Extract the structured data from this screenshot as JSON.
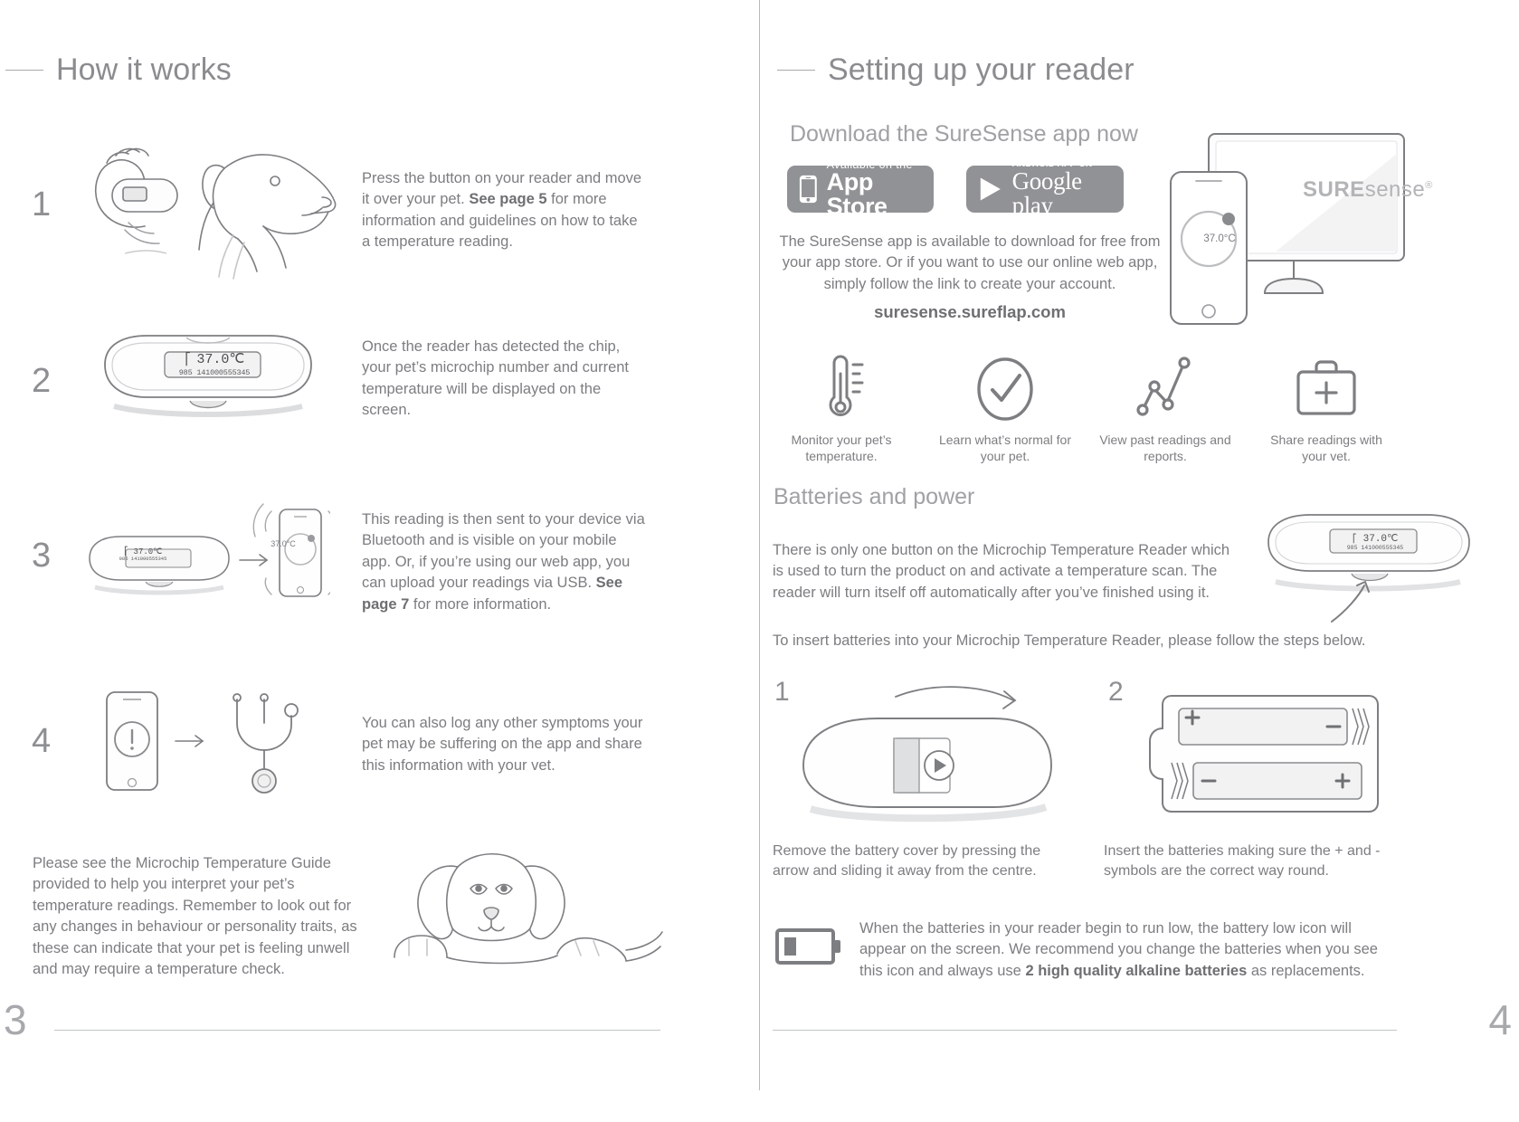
{
  "left_page": {
    "heading": "How it works",
    "folio": "3",
    "steps": [
      {
        "num": "1",
        "text_parts": [
          {
            "t": "Press the button on your reader and move it over your pet. ",
            "b": false
          },
          {
            "t": "See page 5",
            "b": true
          },
          {
            "t": " for more information and guidelines on how to take a temperature reading.",
            "b": false
          }
        ],
        "illustration": "dog-with-reader-illustration"
      },
      {
        "num": "2",
        "text_parts": [
          {
            "t": "Once the reader has detected the chip, your pet’s microchip number and current temperature will be displayed on the screen.",
            "b": false
          }
        ],
        "illustration": "reader-device-illustration"
      },
      {
        "num": "3",
        "text_parts": [
          {
            "t": "This reading is then sent to your device via Bluetooth and is visible on your mobile app. Or, if you’re using our web app, you can upload your readings via USB. ",
            "b": false
          },
          {
            "t": "See page 7",
            "b": true
          },
          {
            "t": " for more information.",
            "b": false
          }
        ],
        "illustration": "reader-to-phone-illustration"
      },
      {
        "num": "4",
        "text_parts": [
          {
            "t": "You can also log any other symptoms your pet may be suffering on the app and share this information with your vet.",
            "b": false
          }
        ],
        "illustration": "phone-to-stethoscope-illustration"
      }
    ],
    "footnote": "Please see the Microchip Temperature Guide provided to help you interpret your pet’s temperature readings. Remember to look out for any changes in behaviour or personality traits, as these can indicate that your pet is feeling unwell and may require a temperature check.",
    "footnote_illustration": "resting-dog-illustration",
    "reader_display": {
      "bluetooth_icon": "bluetooth-icon",
      "temperature": "37.0℃",
      "microchip_number": "985 141000555345"
    },
    "phone_display": {
      "temperature": "37.0°C"
    }
  },
  "right_page": {
    "heading": "Setting up your reader",
    "folio": "4",
    "download_section": {
      "sub_heading": "Download the SureSense app now",
      "badges": [
        {
          "name": "app-store-badge",
          "small": "Available on the",
          "big": "App Store",
          "icon": "iphone-icon"
        },
        {
          "name": "google-play-badge",
          "small": "ANDROID APP ON",
          "big": "Google play",
          "icon": "play-triangle-icon"
        }
      ],
      "paragraph": "The SureSense app is available to download for free from your app store. Or if you want to use our online web app, simply follow the link to create your account.",
      "url": "suresense.sureflap.com",
      "device_mockup": {
        "monitor_logo_sure": "SURE",
        "monitor_logo_sense": "sense",
        "monitor_logo_mark": "®",
        "phone_temperature": "37.0°C"
      },
      "features": [
        {
          "icon": "thermometer-icon",
          "caption": "Monitor your pet’s temperature."
        },
        {
          "icon": "check-circle-icon",
          "caption": "Learn what’s normal for your pet."
        },
        {
          "icon": "line-chart-icon",
          "caption": "View past readings and reports."
        },
        {
          "icon": "medical-bag-icon",
          "caption": "Share readings with your vet."
        }
      ]
    },
    "batteries_section": {
      "sub_heading": "Batteries and power",
      "paragraph_1": "There is only one button on the Microchip Temperature Reader which is used to turn the product on and activate a temperature scan. The reader will turn itself off automatically after you’ve finished using it.",
      "paragraph_2": "To insert batteries into your Microchip Temperature Reader, please follow the steps below.",
      "reader_display": {
        "bluetooth_icon": "bluetooth-icon",
        "temperature": "37.0℃",
        "microchip_number": "985 141000555345"
      },
      "steps": [
        {
          "num": "1",
          "caption": "Remove the battery cover by pressing the arrow and sliding it away from the centre.",
          "illustration": "battery-cover-slide-illustration"
        },
        {
          "num": "2",
          "caption": "Insert the batteries making sure the + and - symbols are the correct way round.",
          "illustration": "battery-insert-illustration"
        }
      ],
      "low_battery": {
        "icon": "battery-low-icon",
        "text_parts": [
          {
            "t": "When the batteries in your reader begin to run low, the battery low icon will appear on the screen. We recommend you change the batteries when you see this icon and always use ",
            "b": false
          },
          {
            "t": "2 high quality alkaline batteries",
            "b": true
          },
          {
            "t": " as replacements.",
            "b": false
          }
        ]
      }
    }
  },
  "colors": {
    "text": "#7c7d80",
    "heading": "#8b8c8f",
    "line": "#a9aaad",
    "badge_grey": "#919295",
    "illustration_stroke": "#6f7073",
    "illustration_fill": "#ececec"
  }
}
